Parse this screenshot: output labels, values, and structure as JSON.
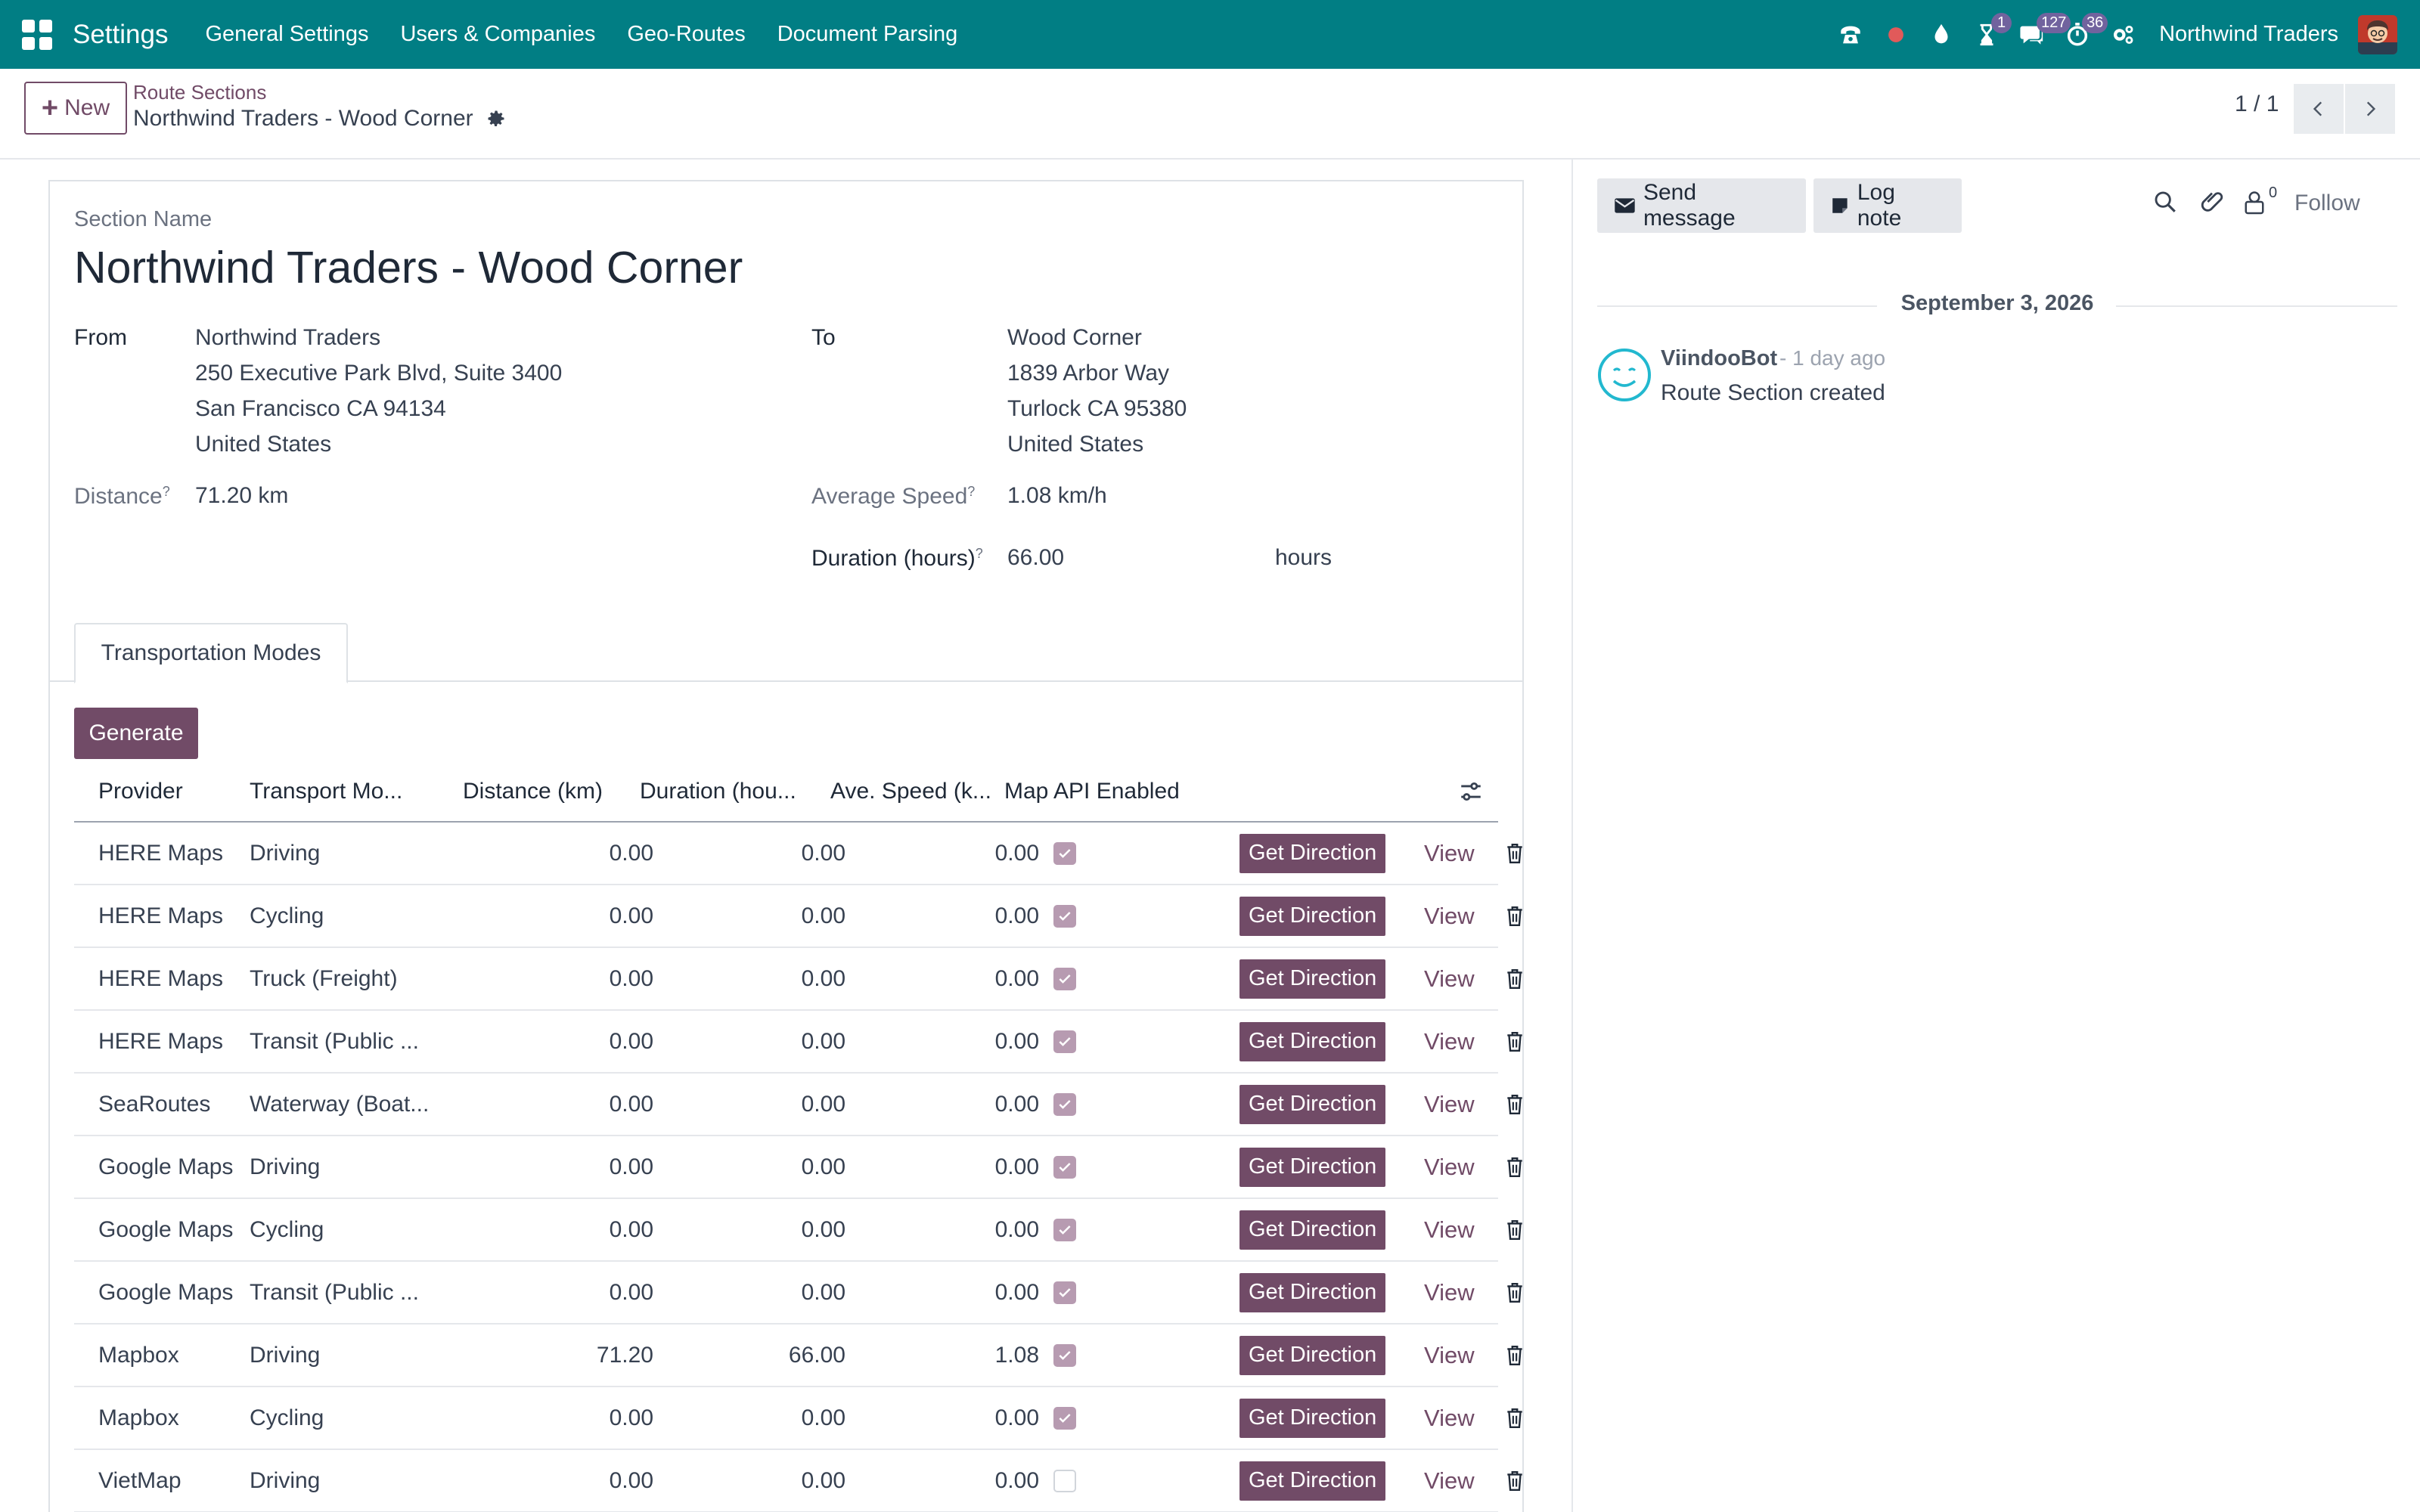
{
  "navbar": {
    "app_title": "Settings",
    "menus": [
      "General Settings",
      "Users & Companies",
      "Geo-Routes",
      "Document Parsing"
    ],
    "badges": {
      "activities": "1",
      "messages": "127",
      "timer": "36"
    },
    "company": "Northwind Traders"
  },
  "control_panel": {
    "new_label": "New",
    "breadcrumb_parent": "Route Sections",
    "breadcrumb_current": "Northwind Traders - Wood Corner",
    "pager": "1 / 1"
  },
  "form": {
    "section_name_label": "Section Name",
    "section_name": "Northwind Traders - Wood Corner",
    "from_label": "From",
    "from_lines": [
      "Northwind Traders",
      "250 Executive Park Blvd, Suite 3400",
      "San Francisco CA 94134",
      "United States"
    ],
    "to_label": "To",
    "to_lines": [
      "Wood Corner",
      "1839 Arbor Way",
      "Turlock CA 95380",
      "United States"
    ],
    "distance_label": "Distance",
    "distance_value": "71.20 km",
    "avg_speed_label": "Average Speed",
    "avg_speed_value": "1.08 km/h",
    "duration_label": "Duration (hours)",
    "duration_value": "66.00",
    "duration_unit": "hours",
    "help_mark": "?",
    "tab_label": "Transportation Modes",
    "generate_label": "Generate"
  },
  "table": {
    "headers": [
      "Provider",
      "Transport Mo...",
      "Distance (km)",
      "Duration (hou...",
      "Ave. Speed (k...",
      "Map API Enabled"
    ],
    "action_label": "Get Direction",
    "view_label": "View",
    "rows": [
      {
        "provider": "HERE Maps",
        "mode": "Driving",
        "distance": "0.00",
        "duration": "0.00",
        "speed": "0.00",
        "api": true
      },
      {
        "provider": "HERE Maps",
        "mode": "Cycling",
        "distance": "0.00",
        "duration": "0.00",
        "speed": "0.00",
        "api": true
      },
      {
        "provider": "HERE Maps",
        "mode": "Truck (Freight)",
        "distance": "0.00",
        "duration": "0.00",
        "speed": "0.00",
        "api": true
      },
      {
        "provider": "HERE Maps",
        "mode": "Transit (Public ...",
        "distance": "0.00",
        "duration": "0.00",
        "speed": "0.00",
        "api": true
      },
      {
        "provider": "SeaRoutes",
        "mode": "Waterway (Boat...",
        "distance": "0.00",
        "duration": "0.00",
        "speed": "0.00",
        "api": true
      },
      {
        "provider": "Google Maps",
        "mode": "Driving",
        "distance": "0.00",
        "duration": "0.00",
        "speed": "0.00",
        "api": true
      },
      {
        "provider": "Google Maps",
        "mode": "Cycling",
        "distance": "0.00",
        "duration": "0.00",
        "speed": "0.00",
        "api": true
      },
      {
        "provider": "Google Maps",
        "mode": "Transit (Public ...",
        "distance": "0.00",
        "duration": "0.00",
        "speed": "0.00",
        "api": true
      },
      {
        "provider": "Mapbox",
        "mode": "Driving",
        "distance": "71.20",
        "duration": "66.00",
        "speed": "1.08",
        "api": true
      },
      {
        "provider": "Mapbox",
        "mode": "Cycling",
        "distance": "0.00",
        "duration": "0.00",
        "speed": "0.00",
        "api": true
      },
      {
        "provider": "VietMap",
        "mode": "Driving",
        "distance": "0.00",
        "duration": "0.00",
        "speed": "0.00",
        "api": false
      }
    ]
  },
  "chatter": {
    "send_message_label": "Send message",
    "log_note_label": "Log note",
    "followers_count": "0",
    "follow_label": "Follow",
    "date_separator": "September 3, 2026",
    "message": {
      "author": "ViindooBot",
      "time": "- 1 day ago",
      "body": "Route Section created"
    }
  },
  "colors": {
    "navbar": "#017e84",
    "primary": "#714b67",
    "checkbox_checked": "#b79bb1"
  }
}
